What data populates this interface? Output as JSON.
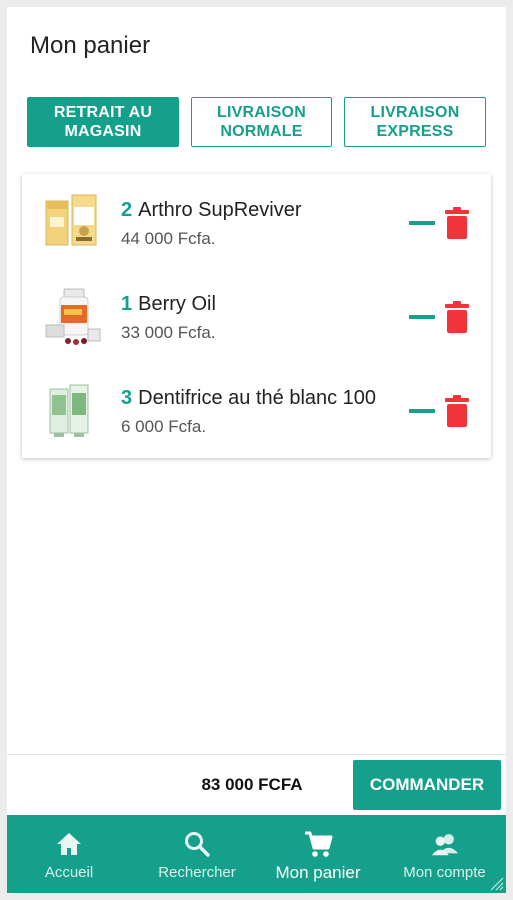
{
  "header": {
    "title": "Mon panier"
  },
  "delivery_tabs": [
    {
      "label": "RETRAIT AU\nMAGASIN",
      "active": true
    },
    {
      "label": "LIVRAISON\nNORMALE",
      "active": false
    },
    {
      "label": "LIVRAISON\nEXPRESS",
      "active": false
    }
  ],
  "cart": {
    "items": [
      {
        "qty": "2",
        "name": "Arthro SupReviver",
        "price": "44 000 Fcfa.",
        "image": "arthro-box-image"
      },
      {
        "qty": "1",
        "name": "Berry Oil",
        "price": "33 000 Fcfa.",
        "image": "berry-oil-bottle-image"
      },
      {
        "qty": "3",
        "name": "Dentifrice au thé blanc 100",
        "price": "6 000 Fcfa.",
        "image": "toothpaste-tubes-image"
      }
    ]
  },
  "footer": {
    "total": "83 000 FCFA",
    "order_label": "COMMANDER"
  },
  "nav": [
    {
      "label": "Accueil",
      "icon": "home-icon",
      "active": false
    },
    {
      "label": "Rechercher",
      "icon": "search-icon",
      "active": false
    },
    {
      "label": "Mon panier",
      "icon": "cart-icon",
      "active": true
    },
    {
      "label": "Mon compte",
      "icon": "account-icon",
      "active": false
    }
  ],
  "colors": {
    "accent": "#15a08b",
    "delete": "#f0353a"
  }
}
